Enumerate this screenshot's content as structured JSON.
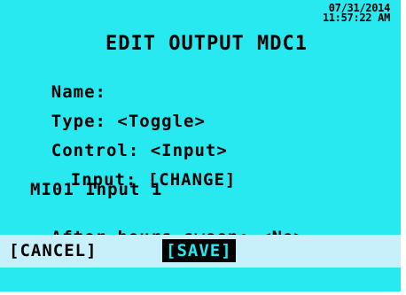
{
  "status": {
    "date": "07/31/2014",
    "time": "11:57:22 AM"
  },
  "screen_title": "EDIT OUTPUT MDC1",
  "fields": {
    "name": {
      "label": "Name:",
      "value": ""
    },
    "type": {
      "label": "Type:",
      "value": "<Toggle>"
    },
    "control": {
      "label": "Control:",
      "value": "<Input>"
    },
    "input": {
      "label": "Input:",
      "value": "[CHANGE]"
    },
    "input_source": "MI01 Input 1",
    "after_hours_sweep": {
      "label": "After-hours sweep:",
      "value": "<No>"
    }
  },
  "actions": {
    "cancel_label": "[CANCEL]",
    "save_label": "[SAVE]"
  },
  "colors": {
    "screen_background": "#28e8f0",
    "action_bar_background": "#c8f0fa",
    "text": "#000000",
    "selected_button_background": "#000000"
  }
}
